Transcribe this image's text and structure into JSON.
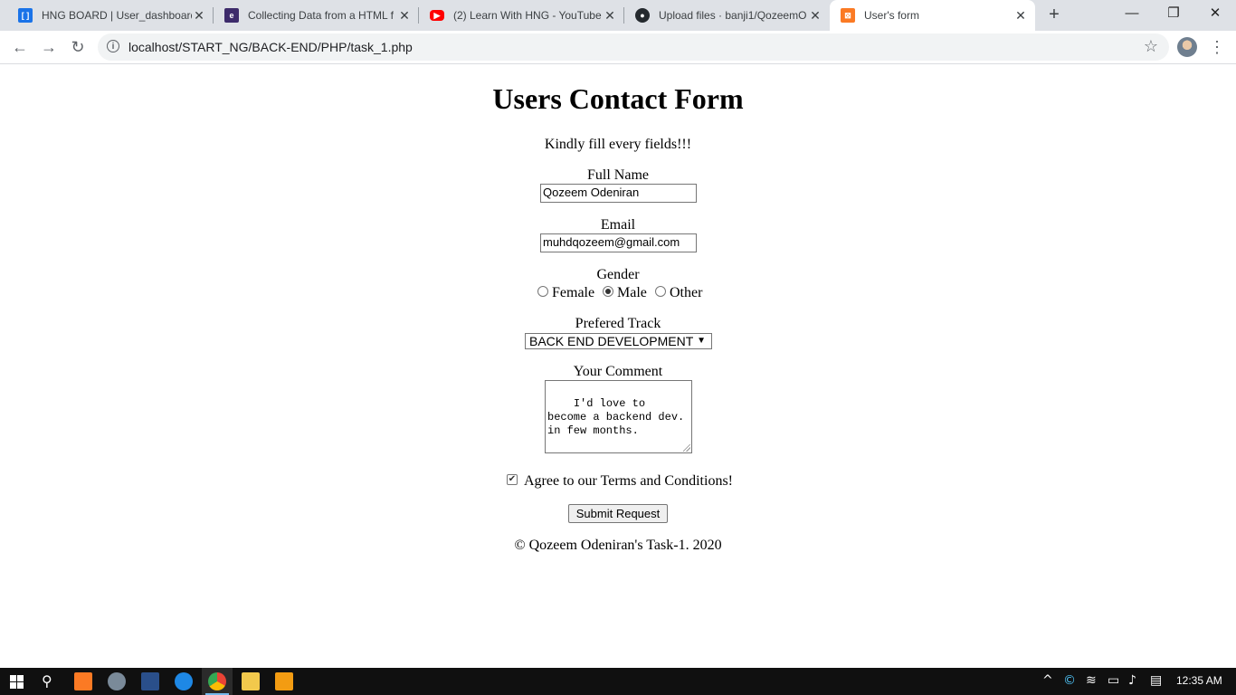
{
  "browser": {
    "tabs": [
      {
        "title": "HNG BOARD | User_dashboard",
        "favicon": "hng-board-icon",
        "color": "#1a73e8"
      },
      {
        "title": "Collecting Data from a HTML f",
        "favicon": "tutorial-site-icon",
        "color": "#3d2b6b"
      },
      {
        "title": "(2) Learn With HNG - YouTube",
        "favicon": "youtube-icon",
        "color": "#ff0000"
      },
      {
        "title": "Upload files · banji1/QozeemO",
        "favicon": "github-icon",
        "color": "#24292e"
      },
      {
        "title": "User's form",
        "favicon": "xampp-icon",
        "color": "#fb7a24"
      }
    ],
    "url": "localhost/START_NG/BACK-END/PHP/task_1.php"
  },
  "form": {
    "heading": "Users Contact Form",
    "instruction": "Kindly fill every fields!!!",
    "full_name_label": "Full Name",
    "full_name_value": "Qozeem Odeniran",
    "email_label": "Email",
    "email_value": "muhdqozeem@gmail.com",
    "gender_label": "Gender",
    "gender_options": [
      "Female",
      "Male",
      "Other"
    ],
    "gender_selected": "Male",
    "track_label": "Prefered Track",
    "track_value": "BACK END DEVELOPMENT",
    "comment_label": "Your Comment",
    "comment_value": "I'd love to become a backend dev. in few months.",
    "terms_label": "Agree to our Terms and Conditions!",
    "terms_checked": true,
    "submit_label": "Submit Request",
    "footer": "© Qozeem Odeniran's Task-1. 2020"
  },
  "taskbar": {
    "time": "12:35 AM"
  }
}
